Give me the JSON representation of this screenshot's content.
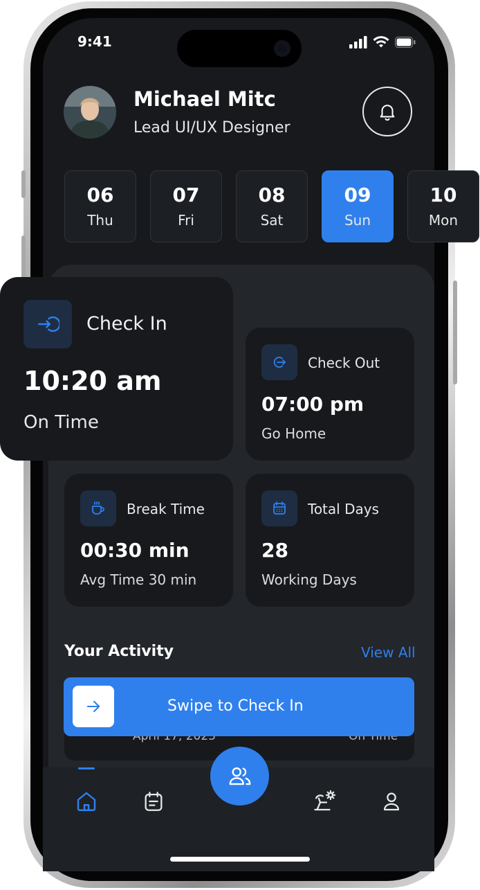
{
  "status_bar": {
    "time": "9:41"
  },
  "profile": {
    "name": "Michael Mitc",
    "role": "Lead UI/UX Designer"
  },
  "dates": [
    {
      "num": "06",
      "day": "Thu",
      "selected": false
    },
    {
      "num": "07",
      "day": "Fri",
      "selected": false
    },
    {
      "num": "08",
      "day": "Sat",
      "selected": false
    },
    {
      "num": "09",
      "day": "Sun",
      "selected": true
    },
    {
      "num": "10",
      "day": "Mon",
      "selected": false
    }
  ],
  "cards": {
    "check_in": {
      "title": "Check In",
      "value": "10:20 am",
      "sub": "On Time",
      "icon": "login-arrow-icon"
    },
    "check_out": {
      "title": "Check Out",
      "value": "07:00 pm",
      "sub": "Go Home",
      "icon": "logout-arrow-icon"
    },
    "break_time": {
      "title": "Break Time",
      "value": "00:30 min",
      "sub": "Avg Time 30 min",
      "icon": "coffee-cup-icon"
    },
    "total_days": {
      "title": "Total Days",
      "value": "28",
      "sub": "Working Days",
      "icon": "calendar-icon"
    }
  },
  "activity": {
    "title": "Your Activity",
    "view_all": "View All",
    "peek_item": {
      "date": "April 17, 2023",
      "status": "On Time"
    }
  },
  "swipe": {
    "label": "Swipe to Check In"
  },
  "nav": {
    "items": [
      "home-icon",
      "calendar-note-icon",
      "team-icon",
      "holiday-icon",
      "profile-icon"
    ],
    "active": "home-icon"
  },
  "colors": {
    "accent": "#2f80ed",
    "background": "#17191d",
    "panel": "#23262b",
    "card": "#17191d"
  }
}
